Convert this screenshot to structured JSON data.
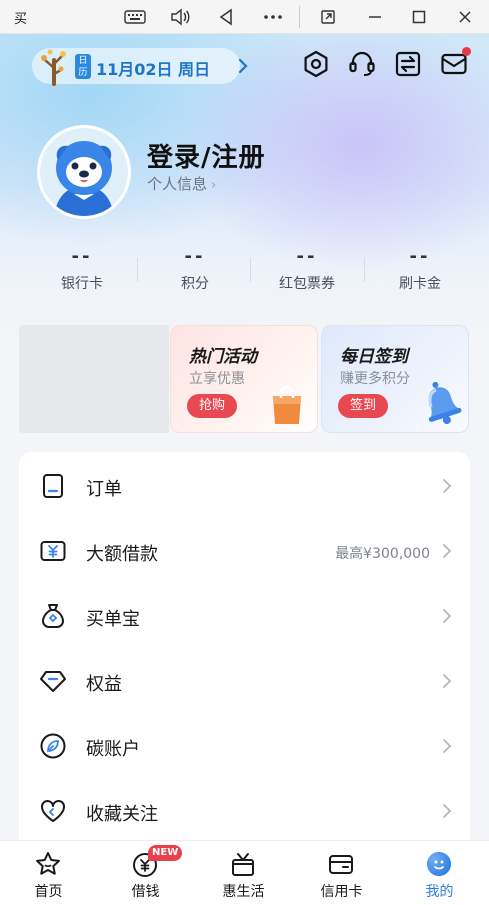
{
  "system_bar": {
    "app_title": "买"
  },
  "header": {
    "calendar_tag": "日历",
    "date": "11月02日 周日",
    "login_title": "登录/注册",
    "profile_link": "个人信息"
  },
  "stats": [
    {
      "value": "--",
      "label": "银行卡"
    },
    {
      "value": "--",
      "label": "积分"
    },
    {
      "value": "--",
      "label": "红包票券"
    },
    {
      "value": "--",
      "label": "刷卡金"
    }
  ],
  "promos": {
    "hot": {
      "title": "热门活动",
      "subtitle": "立享优惠",
      "button": "抢购"
    },
    "sign": {
      "title": "每日签到",
      "subtitle": "赚更多积分",
      "button": "签到"
    }
  },
  "menu": [
    {
      "label": "订单",
      "extra": "",
      "icon": "order-icon"
    },
    {
      "label": "大额借款",
      "extra": "最高¥300,000",
      "icon": "loan-icon"
    },
    {
      "label": "买单宝",
      "extra": "",
      "icon": "money-bag-icon"
    },
    {
      "label": "权益",
      "extra": "",
      "icon": "diamond-icon"
    },
    {
      "label": "碳账户",
      "extra": "",
      "icon": "leaf-icon"
    },
    {
      "label": "收藏关注",
      "extra": "",
      "icon": "heart-icon"
    }
  ],
  "bottom_nav": {
    "items": [
      {
        "label": "首页",
        "icon": "star-icon"
      },
      {
        "label": "借钱",
        "icon": "yuan-icon",
        "badge": "NEW"
      },
      {
        "label": "惠生活",
        "icon": "gift-icon"
      },
      {
        "label": "信用卡",
        "icon": "card-icon"
      },
      {
        "label": "我的",
        "icon": "profile-icon"
      }
    ],
    "active": "我的"
  },
  "colors": {
    "accent_blue": "#2a7de1",
    "date_blue": "#1f74c9",
    "promo_red": "#e84852",
    "badge_red": "#e53946"
  }
}
